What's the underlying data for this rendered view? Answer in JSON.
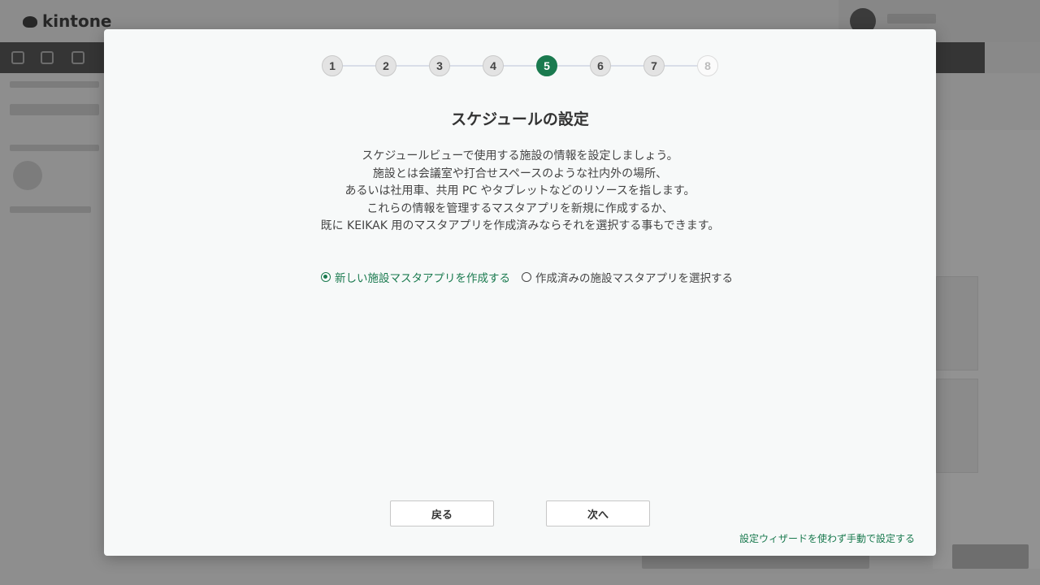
{
  "background": {
    "logo_text": "kintone"
  },
  "wizard": {
    "steps": [
      "1",
      "2",
      "3",
      "4",
      "5",
      "6",
      "7",
      "8"
    ],
    "current_step": 5,
    "title": "スケジュールの設定",
    "description_lines": [
      "スケジュールビューで使用する施設の情報を設定しましょう。",
      "施設とは会議室や打合せスペースのような社内外の場所、",
      "あるいは社用車、共用 PC やタブレットなどのリソースを指します。",
      "これらの情報を管理するマスタアプリを新規に作成するか、",
      "既に KEIKAK 用のマスタアプリを作成済みならそれを選択する事もできます。"
    ],
    "options": {
      "create_new": "新しい施設マスタアプリを作成する",
      "select_existing": "作成済みの施設マスタアプリを選択する",
      "selected": "create_new"
    },
    "back_label": "戻る",
    "next_label": "次へ",
    "manual_link": "設定ウィザードを使わず手動で設定する"
  },
  "colors": {
    "accent": "#1a7a4f",
    "modal_bg": "#f7f9f9"
  }
}
